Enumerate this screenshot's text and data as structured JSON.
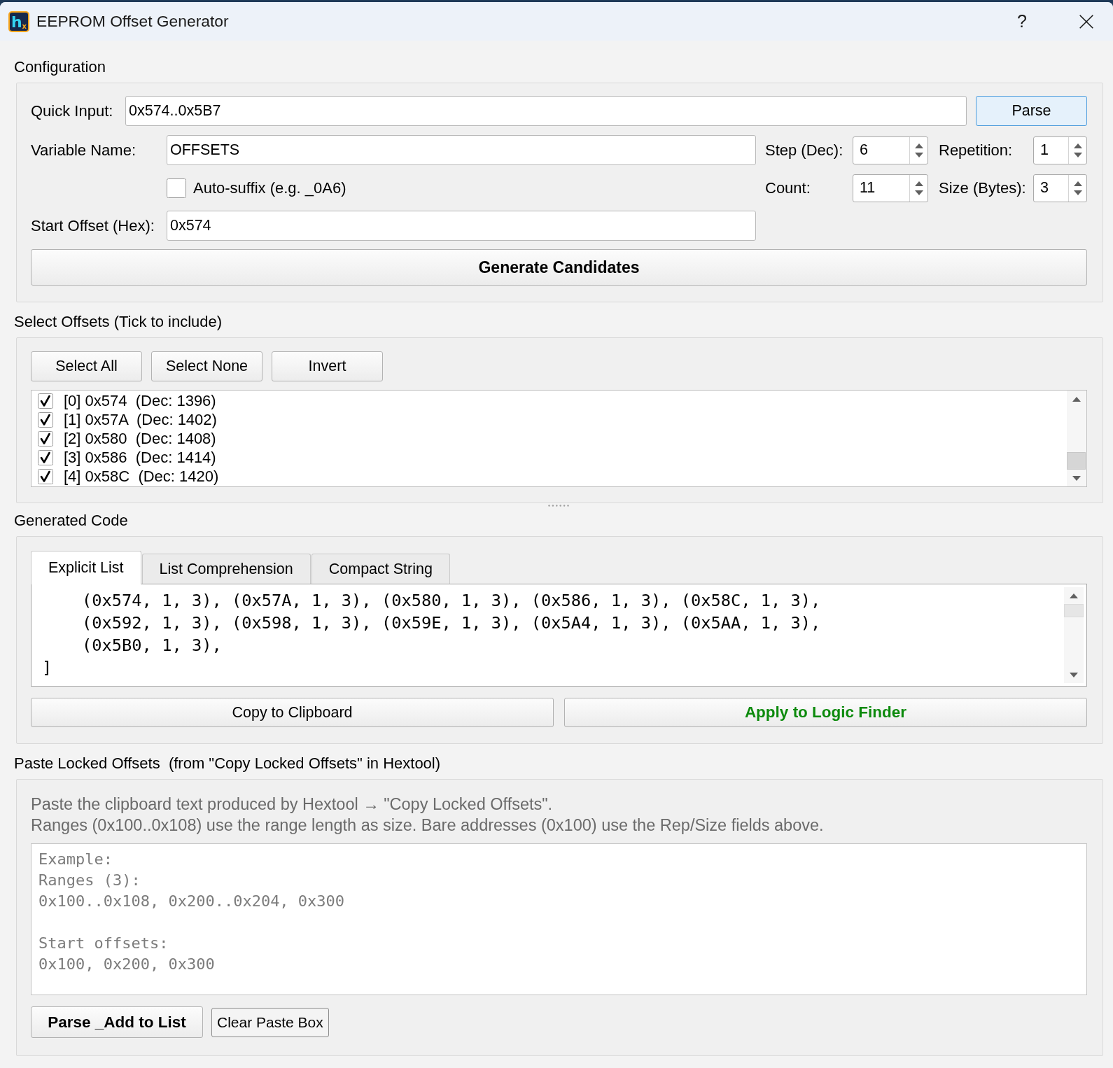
{
  "window": {
    "logo": {
      "letter": "h",
      "subscript": "x"
    },
    "title": "EEPROM Offset Generator",
    "help": "?"
  },
  "configuration": {
    "title": "Configuration",
    "quick_input": {
      "label": "Quick Input:",
      "value": "0x574..0x5B7"
    },
    "parse_button": "Parse",
    "variable_name": {
      "label": "Variable Name:",
      "value": "OFFSETS"
    },
    "auto_suffix": {
      "label": "Auto-suffix (e.g. _0A6)",
      "checked": false
    },
    "start_offset": {
      "label": "Start Offset (Hex):",
      "value": "0x574"
    },
    "spinboxes": [
      {
        "label": "Step (Dec):",
        "value": "6"
      },
      {
        "label": "Repetition:",
        "value": "1"
      },
      {
        "label": "Count:",
        "value": "11"
      },
      {
        "label": "Size (Bytes):",
        "value": "3"
      }
    ],
    "generate_button": "Generate Candidates"
  },
  "select_offsets": {
    "title": "Select Offsets (Tick to include)",
    "buttons": [
      "Select All",
      "Select None",
      "Invert"
    ],
    "items": [
      {
        "label": "[0] 0x574  (Dec: 1396)",
        "checked": true
      },
      {
        "label": "[1] 0x57A  (Dec: 1402)",
        "checked": true
      },
      {
        "label": "[2] 0x580  (Dec: 1408)",
        "checked": true
      },
      {
        "label": "[3] 0x586  (Dec: 1414)",
        "checked": true
      },
      {
        "label": "[4] 0x58C  (Dec: 1420)",
        "checked": true
      }
    ]
  },
  "generated_code": {
    "title": "Generated Code",
    "tabs": [
      {
        "label": "Explicit List",
        "selected": true
      },
      {
        "label": "List Comprehension",
        "selected": false
      },
      {
        "label": "Compact String",
        "selected": false
      }
    ],
    "code_lines": [
      "    (0x574, 1, 3), (0x57A, 1, 3), (0x580, 1, 3), (0x586, 1, 3), (0x58C, 1, 3),",
      "    (0x592, 1, 3), (0x598, 1, 3), (0x59E, 1, 3), (0x5A4, 1, 3), (0x5AA, 1, 3),",
      "    (0x5B0, 1, 3),",
      "]"
    ],
    "buttons": [
      {
        "label": "Copy to Clipboard",
        "kind": "normal"
      },
      {
        "label": "Apply to Logic Finder",
        "kind": "accent"
      }
    ]
  },
  "paste_locked_offsets": {
    "title": "Paste Locked Offsets  (from \"Copy Locked Offsets\" in Hextool)",
    "description": [
      "Paste the clipboard text produced by Hextool → \"Copy Locked Offsets\".",
      "Ranges (0x100..0x108) use the range length as size. Bare addresses (0x100) use the Rep/Size fields above."
    ],
    "paste_box": {
      "placeholder": "Example:\nRanges (3):\n0x100..0x108, 0x200..0x204, 0x300\n\nStart offsets:\n0x100, 0x200, 0x300"
    },
    "buttons": [
      {
        "label": "Parse _Add to List",
        "kind": "bold"
      },
      {
        "label": "Clear Paste Box",
        "kind": "compact"
      }
    ]
  }
}
